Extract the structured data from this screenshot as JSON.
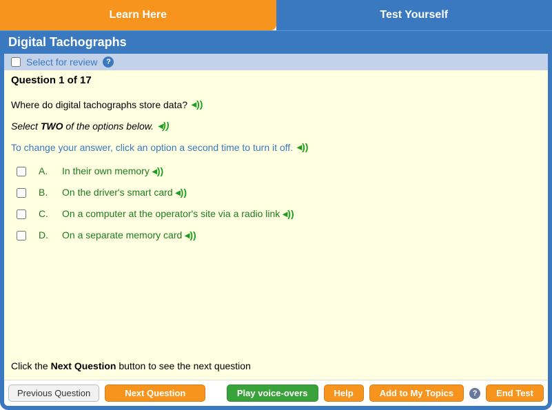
{
  "tabs": {
    "learn": "Learn Here",
    "test": "Test Yourself"
  },
  "section_title": "Digital Tachographs",
  "review": {
    "label": "Select for review"
  },
  "question": {
    "number_label": "Question 1 of 17",
    "text": "Where do digital tachographs store data?",
    "instruction_prefix": "Select ",
    "instruction_bold": "TWO",
    "instruction_suffix": " of the options below.",
    "change_hint": "To change your answer, click an option a second time to turn it off.",
    "options": [
      {
        "letter": "A.",
        "text": "In their own memory"
      },
      {
        "letter": "B.",
        "text": "On the driver's smart card"
      },
      {
        "letter": "C.",
        "text": "On a computer at the operator's site via a radio link"
      },
      {
        "letter": "D.",
        "text": "On a separate memory card"
      }
    ]
  },
  "footer_hint_prefix": "Click the ",
  "footer_hint_bold": "Next Question",
  "footer_hint_suffix": " button to see the next question",
  "buttons": {
    "previous": "Previous Question",
    "next": "Next Question",
    "play": "Play voice-overs",
    "help": "Help",
    "add": "Add to My Topics",
    "end": "End Test"
  },
  "icons": {
    "audio": "◂))",
    "question_mark": "?"
  }
}
